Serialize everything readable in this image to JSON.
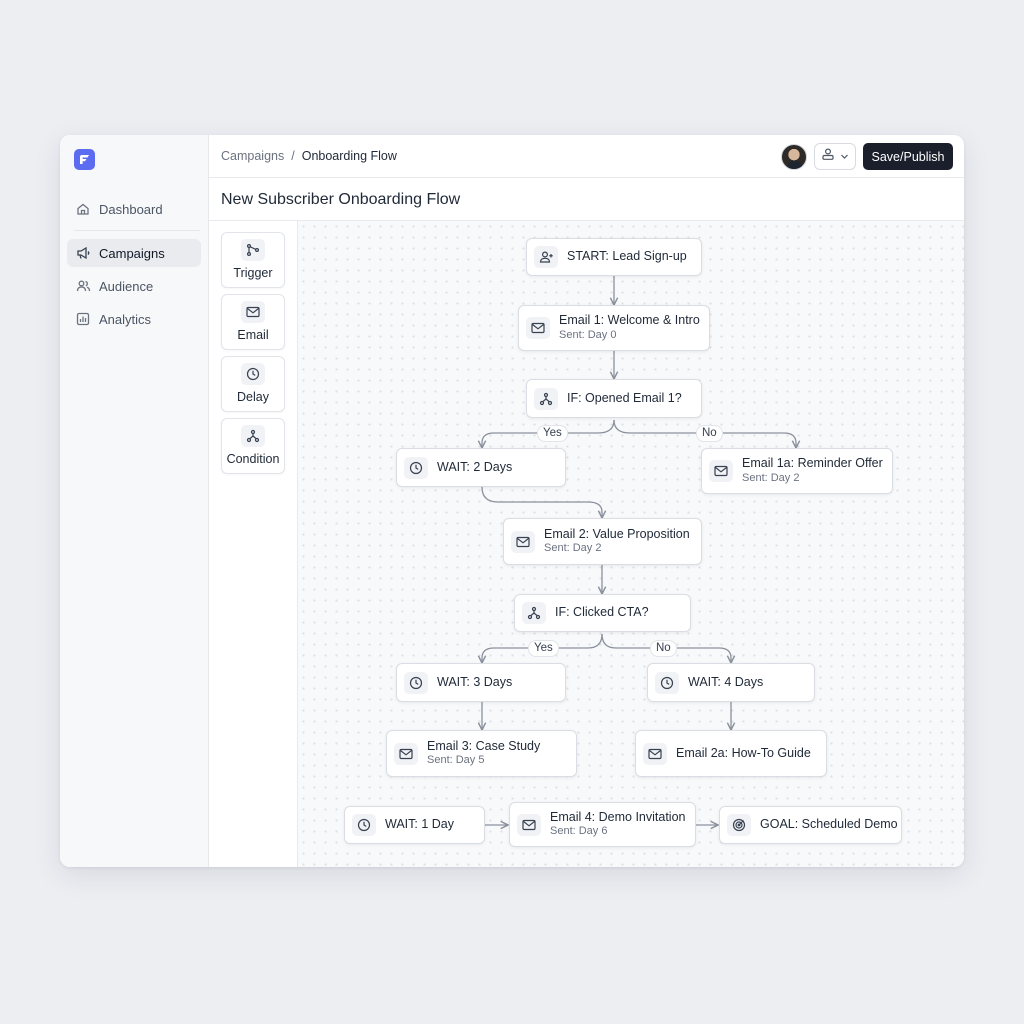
{
  "sidebar": {
    "items": [
      {
        "label": "Dashboard",
        "icon": "home-icon",
        "active": false
      },
      {
        "label": "Campaigns",
        "icon": "megaphone-icon",
        "active": true
      },
      {
        "label": "Audience",
        "icon": "users-icon",
        "active": false
      },
      {
        "label": "Analytics",
        "icon": "bar-chart-icon",
        "active": false
      }
    ]
  },
  "header": {
    "breadcrumb": {
      "parent": "Campaigns",
      "separator": "/",
      "current": "Onboarding Flow"
    },
    "publish_label": "Save/Publish"
  },
  "page": {
    "title": "New Subscriber Onboarding Flow"
  },
  "palette": {
    "items": [
      {
        "label": "Trigger",
        "icon": "trigger-icon"
      },
      {
        "label": "Email",
        "icon": "mail-icon"
      },
      {
        "label": "Delay",
        "icon": "clock-icon"
      },
      {
        "label": "Condition",
        "icon": "branch-icon"
      }
    ]
  },
  "flow": {
    "start": {
      "title": "START: Lead Sign-up"
    },
    "email1": {
      "title": "Email 1: Welcome & Intro",
      "sub": "Sent: Day 0"
    },
    "if1": {
      "title": "IF: Opened Email 1?"
    },
    "wait2": {
      "title": "WAIT: 2 Days"
    },
    "email1a": {
      "title": "Email 1a: Reminder Offer",
      "sub": "Sent: Day 2"
    },
    "email2": {
      "title": "Email 2: Value Proposition",
      "sub": "Sent: Day 2"
    },
    "if2": {
      "title": "IF: Clicked CTA?"
    },
    "wait3": {
      "title": "WAIT: 3 Days"
    },
    "wait4": {
      "title": "WAIT: 4 Days"
    },
    "email3": {
      "title": "Email 3: Case Study",
      "sub": "Sent: Day 5"
    },
    "email2a": {
      "title": "Email 2a: How-To Guide"
    },
    "wait1": {
      "title": "WAIT: 1 Day"
    },
    "email4": {
      "title": "Email 4: Demo Invitation",
      "sub": "Sent: Day 6"
    },
    "goal": {
      "title": "GOAL: Scheduled Demo"
    },
    "labels": {
      "yes1": "Yes",
      "no1": "No",
      "yes2": "Yes",
      "no2": "No"
    }
  },
  "colors": {
    "accent": "#5b6cf0",
    "primary_button": "#1a1f2b",
    "connector": "#8a919c"
  }
}
